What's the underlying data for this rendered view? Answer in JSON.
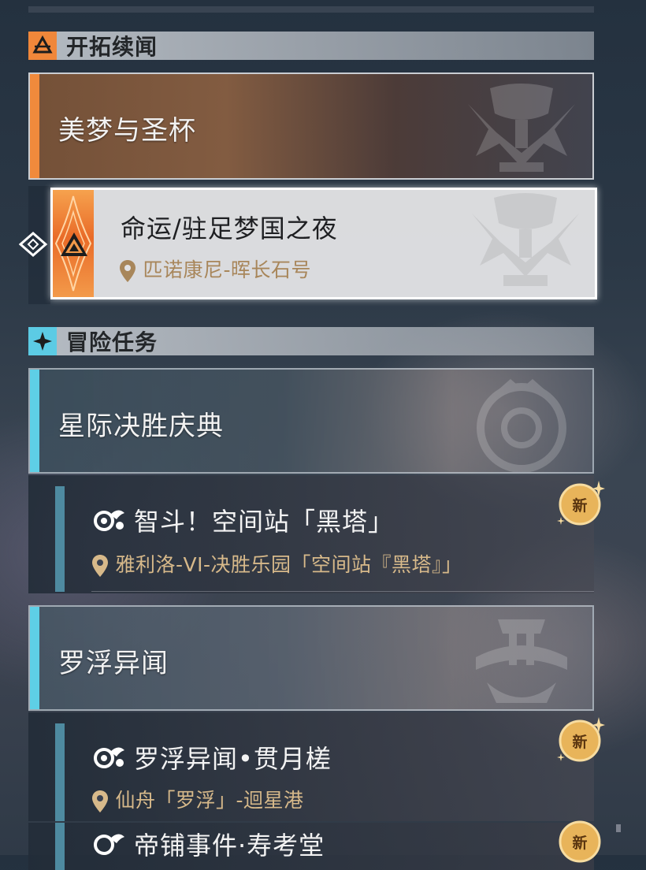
{
  "categories": [
    {
      "title": "开拓续闻",
      "quest": {
        "title": "美梦与圣杯"
      },
      "entries": [
        {
          "name": "命运/驻足梦国之夜",
          "location": "匹诺康尼-晖长石号"
        }
      ]
    },
    {
      "title": "冒险任务",
      "groups": [
        {
          "title": "星际决胜庆典",
          "entries": [
            {
              "name": "智斗！空间站「黑塔」",
              "location": "雅利洛-VI-决胜乐园「空间站『黑塔』」",
              "badge": "新"
            }
          ]
        },
        {
          "title": "罗浮异闻",
          "entries": [
            {
              "name": "罗浮异闻•贯月槎",
              "location": "仙舟「罗浮」-迴星港",
              "badge": "新"
            },
            {
              "name": "帝铺事件·寿考堂",
              "badge": "新"
            }
          ]
        }
      ]
    }
  ],
  "colors": {
    "trailblaze_accent": "#f08a3c",
    "adventure_accent": "#5ecfe6",
    "location_text": "#d7b98a",
    "badge": "#e8b45a"
  }
}
